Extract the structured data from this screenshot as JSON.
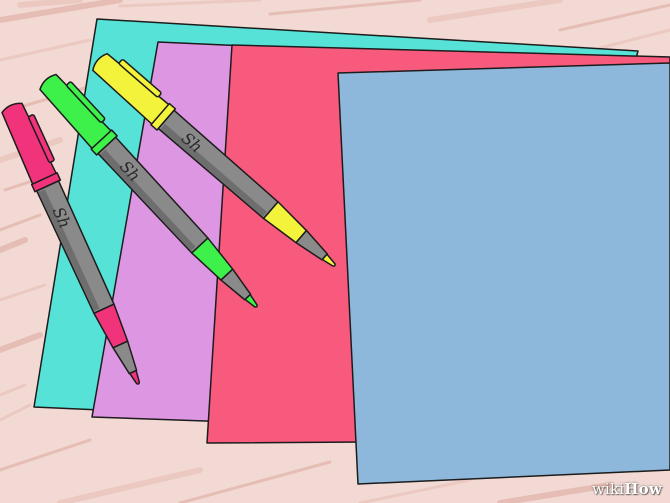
{
  "scene": {
    "description_label": "Colored paper sheets and permanent markers on wood table",
    "colors": {
      "table_base": "#f2d9d3",
      "table_grain": "#e7c0b8",
      "table_grain_light": "#f7e6e2",
      "sheet_turquoise": "#57e2d7",
      "sheet_purple": "#dc96e2",
      "sheet_pink": "#f75a7c",
      "sheet_blue": "#8eb8db",
      "marker_body": "#8a8a8a",
      "marker_body_dark": "#6e6e6e",
      "marker_pink": "#f0337a",
      "marker_green": "#3ef04a",
      "marker_yellow": "#f4f33c",
      "outline": "#1c1c1c"
    },
    "sheets": [
      {
        "name": "turquoise-sheet"
      },
      {
        "name": "purple-sheet"
      },
      {
        "name": "pink-sheet"
      },
      {
        "name": "blue-sheet"
      }
    ],
    "markers": [
      {
        "name": "pink-marker",
        "color": "#f0337a"
      },
      {
        "name": "green-marker",
        "color": "#3ef04a"
      },
      {
        "name": "yellow-marker",
        "color": "#f4f33c"
      }
    ],
    "marker_brand_text": "Sh"
  },
  "watermark": {
    "prefix": "wiki",
    "suffix": "How"
  }
}
